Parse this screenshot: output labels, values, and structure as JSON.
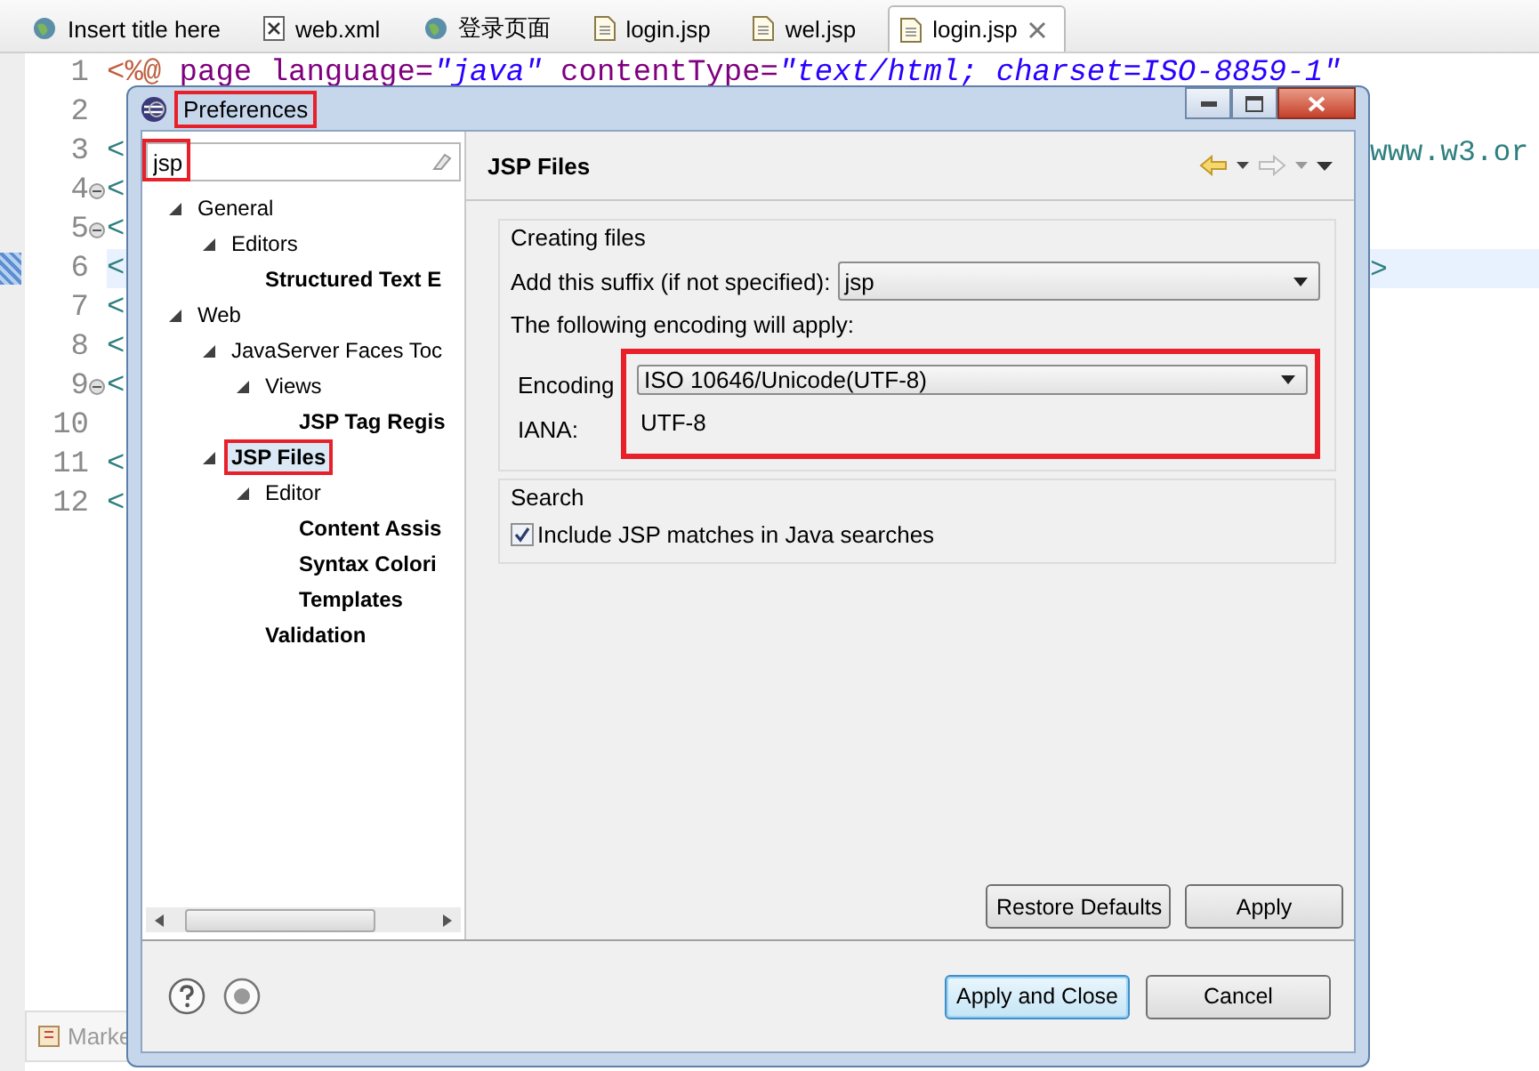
{
  "editor_tabs": [
    {
      "label": "Insert title here",
      "kind": "web",
      "selected": false,
      "closable": false
    },
    {
      "label": "web.xml",
      "kind": "xml",
      "selected": false,
      "closable": false
    },
    {
      "label": "登录页面",
      "kind": "web",
      "selected": false,
      "closable": false
    },
    {
      "label": "login.jsp",
      "kind": "file",
      "selected": false,
      "closable": false
    },
    {
      "label": "wel.jsp",
      "kind": "file",
      "selected": false,
      "closable": false
    },
    {
      "label": "login.jsp",
      "kind": "file",
      "selected": true,
      "closable": true
    }
  ],
  "editor": {
    "lines": [
      {
        "number": "1",
        "folding": false,
        "current": false,
        "tokens": [
          {
            "text": "<%@",
            "kind": "directive"
          },
          {
            "text": " page language=",
            "kind": "attribute"
          },
          {
            "text": "\"java\"",
            "kind": "string"
          },
          {
            "text": " contentType=",
            "kind": "attribute"
          },
          {
            "text": "\"text/html; charset=ISO-8859-1\"",
            "kind": "string"
          }
        ]
      },
      {
        "number": "2",
        "folding": false,
        "current": false
      },
      {
        "number": "3",
        "folding": false,
        "current": false,
        "left": "<",
        "right": "www.w3.or"
      },
      {
        "number": "4",
        "folding": true,
        "current": false,
        "left": "<"
      },
      {
        "number": "5",
        "folding": true,
        "current": false,
        "left": "<"
      },
      {
        "number": "6",
        "folding": false,
        "current": true,
        "left": "<",
        "right": ">"
      },
      {
        "number": "7",
        "folding": false,
        "current": false,
        "left": "<"
      },
      {
        "number": "8",
        "folding": false,
        "current": false,
        "left": "<"
      },
      {
        "number": "9",
        "folding": true,
        "current": false,
        "left": "<"
      },
      {
        "number": "10",
        "folding": false,
        "current": false
      },
      {
        "number": "11",
        "folding": false,
        "current": false,
        "left": "<"
      },
      {
        "number": "12",
        "folding": false,
        "current": false,
        "left": "<"
      }
    ]
  },
  "bottom_views": [
    {
      "label": "Marke"
    }
  ],
  "preferences_dialog": {
    "title": "Preferences",
    "title_highlighted": true,
    "filter": {
      "value": "jsp",
      "highlighted": true
    },
    "tree": [
      {
        "label": "General",
        "expanded": true,
        "matched": false,
        "selected": false,
        "highlighted": false,
        "children": [
          {
            "label": "Editors",
            "expanded": true,
            "matched": false,
            "selected": false,
            "highlighted": false,
            "children": [
              {
                "label": "Structured Text E",
                "matched": true,
                "selected": false,
                "highlighted": false
              }
            ]
          }
        ]
      },
      {
        "label": "Web",
        "expanded": true,
        "matched": false,
        "selected": false,
        "highlighted": false,
        "children": [
          {
            "label": "JavaServer Faces Toc",
            "expanded": true,
            "matched": false,
            "selected": false,
            "highlighted": false,
            "children": [
              {
                "label": "Views",
                "expanded": true,
                "matched": false,
                "selected": false,
                "highlighted": false,
                "children": [
                  {
                    "label": "JSP Tag Regis",
                    "matched": true,
                    "selected": false,
                    "highlighted": false
                  }
                ]
              }
            ]
          },
          {
            "label": "JSP Files",
            "expanded": true,
            "matched": true,
            "selected": true,
            "highlighted": true,
            "children": [
              {
                "label": "Editor",
                "expanded": true,
                "matched": false,
                "selected": false,
                "highlighted": false,
                "children": [
                  {
                    "label": "Content Assis",
                    "matched": true,
                    "selected": false,
                    "highlighted": false
                  },
                  {
                    "label": "Syntax Colori",
                    "matched": true,
                    "selected": false,
                    "highlighted": false
                  },
                  {
                    "label": "Templates",
                    "matched": true,
                    "selected": false,
                    "highlighted": false
                  }
                ]
              },
              {
                "label": "Validation",
                "matched": true,
                "selected": false,
                "highlighted": false
              }
            ]
          }
        ]
      }
    ],
    "page": {
      "title": "JSP Files",
      "back_enabled": true,
      "forward_enabled": false,
      "creating_files": {
        "title": "Creating files",
        "suffix_label": "Add this suffix (if not specified):",
        "suffix_value": "jsp",
        "encoding_note": "The following encoding will apply:",
        "encoding_label": "Encoding",
        "encoding_value": "ISO 10646/Unicode(UTF-8)",
        "iana_label": "IANA:",
        "iana_value": "UTF-8",
        "encoding_highlighted": true
      },
      "search": {
        "title": "Search",
        "include_label": "Include JSP matches in Java searches",
        "include_checked": true
      }
    },
    "page_buttons": [
      "Restore Defaults",
      "Apply"
    ],
    "dialog_buttons": [
      {
        "label": "Apply and Close",
        "default": true
      },
      {
        "label": "Cancel",
        "default": false
      }
    ]
  }
}
